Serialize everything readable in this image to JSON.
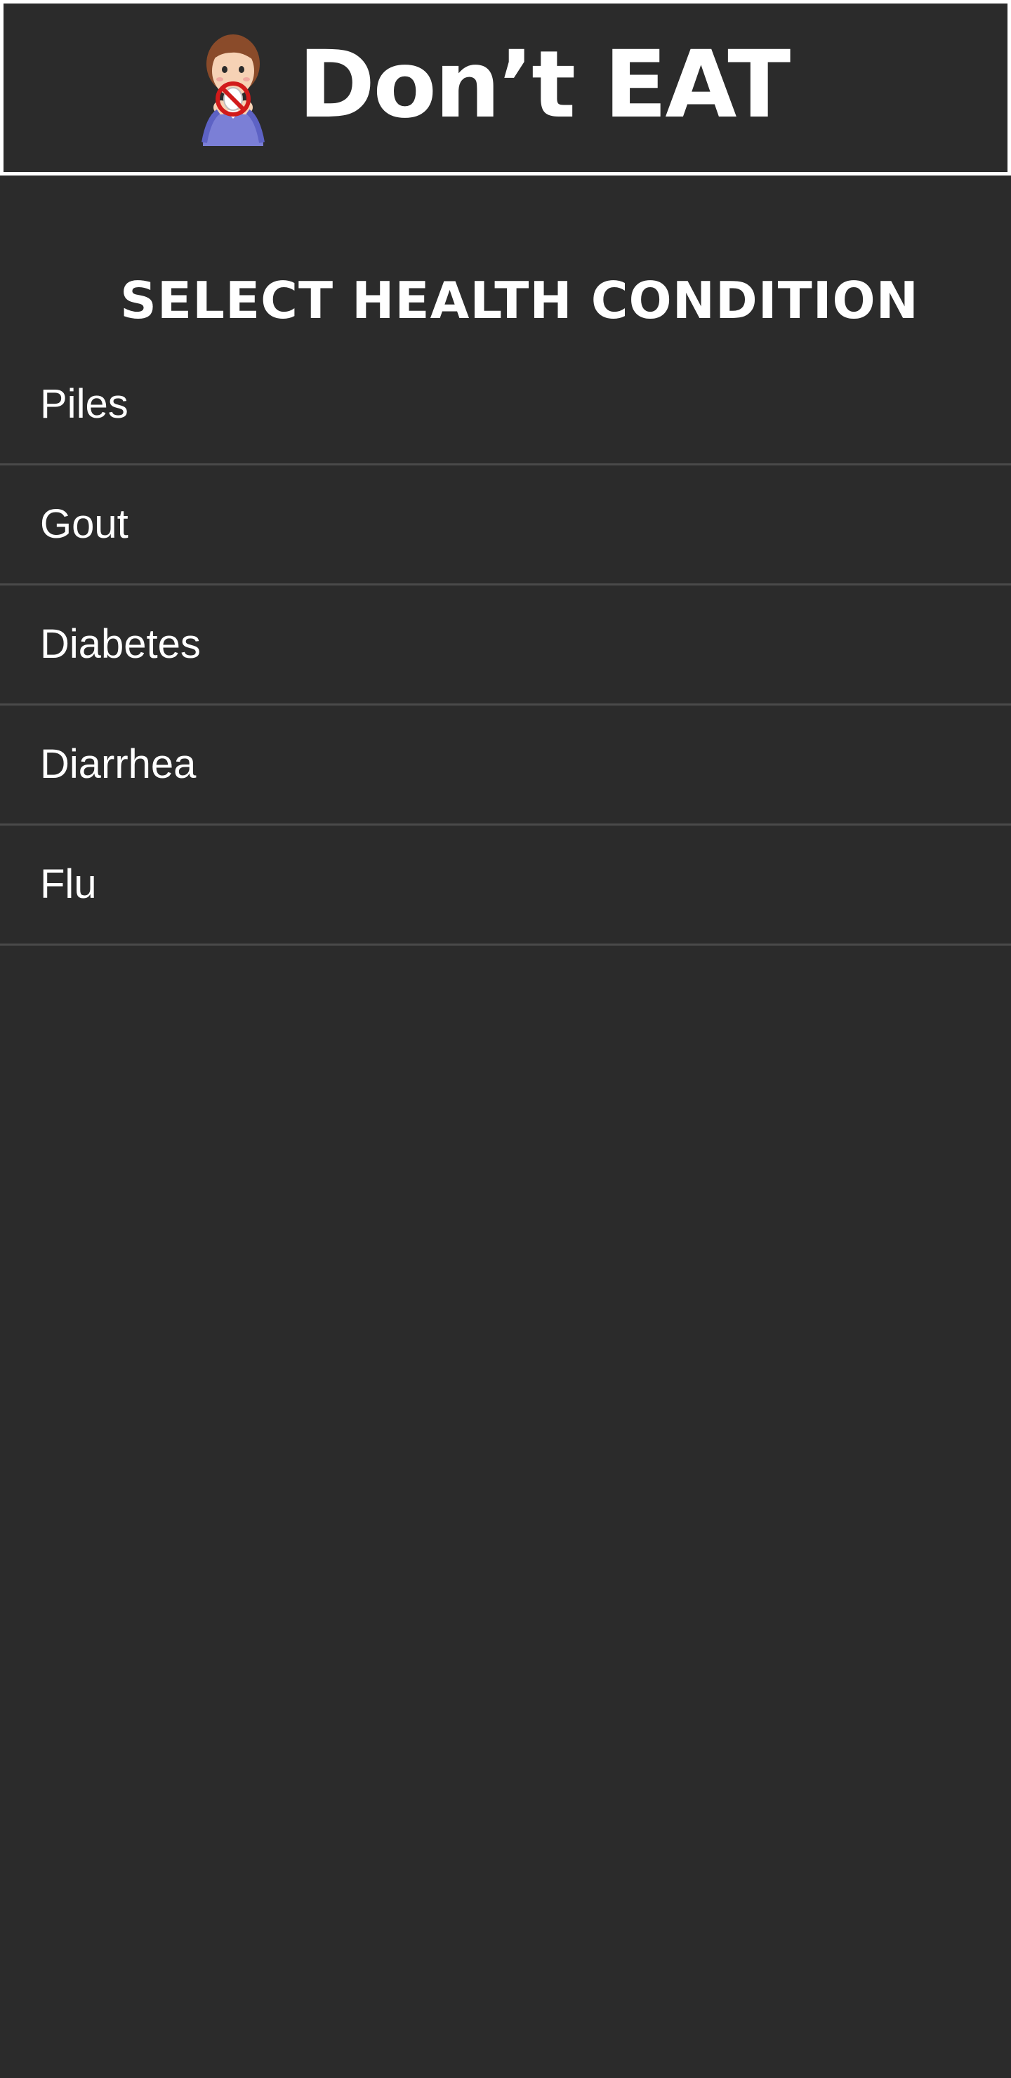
{
  "header": {
    "app_title": "Don’t EAT",
    "logo_icon": "person-no-eating-icon"
  },
  "main": {
    "section_title": "SELECT HEALTH CONDITION",
    "conditions": [
      {
        "label": "Piles"
      },
      {
        "label": "Gout"
      },
      {
        "label": "Diabetes"
      },
      {
        "label": "Diarrhea"
      },
      {
        "label": "Flu"
      }
    ]
  },
  "colors": {
    "background": "#2b2b2b",
    "text": "#ffffff",
    "divider": "#4a4a4a",
    "header_border": "#ffffff",
    "prohibition_red": "#d11a1a"
  }
}
